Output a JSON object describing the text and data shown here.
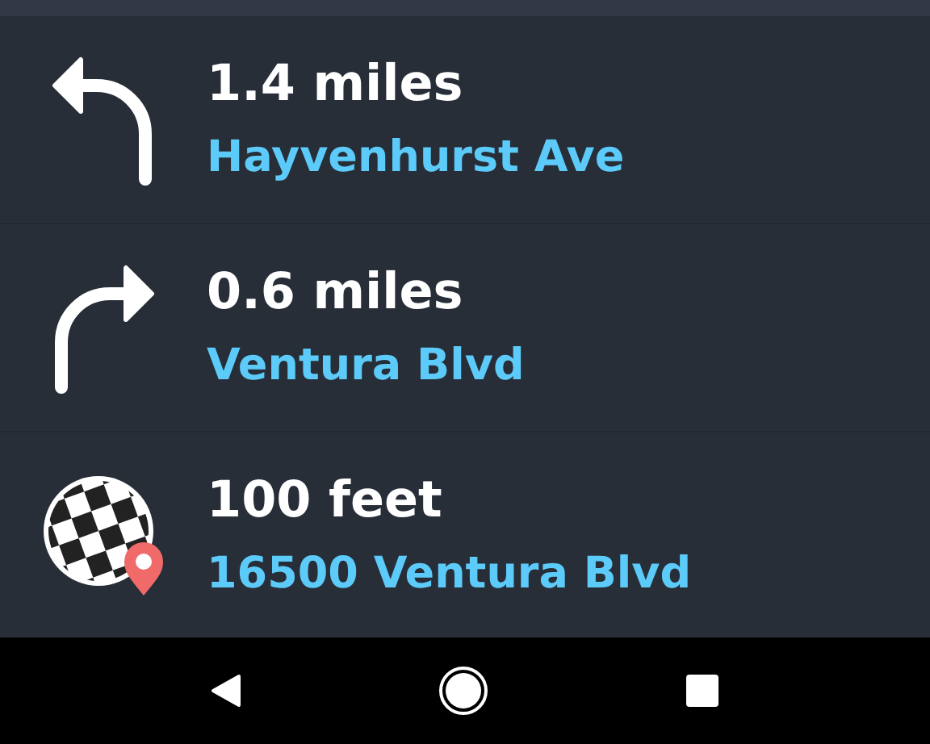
{
  "steps": [
    {
      "kind": "turn-left",
      "distance": "1.4 miles",
      "street": "Hayvenhurst Ave"
    },
    {
      "kind": "turn-right",
      "distance": "0.6 miles",
      "street": "Ventura Blvd"
    },
    {
      "kind": "destination",
      "distance": "100 feet",
      "street": "16500 Ventura Blvd"
    }
  ]
}
